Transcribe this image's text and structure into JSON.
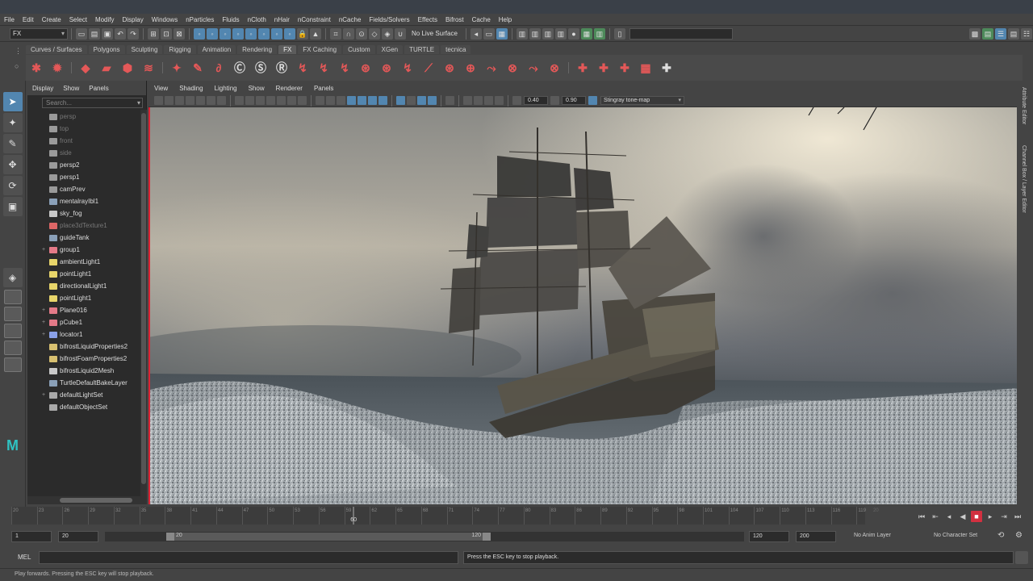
{
  "menubar": {
    "items": [
      "File",
      "Edit",
      "Create",
      "Select",
      "Modify",
      "Display",
      "Windows",
      "nParticles",
      "Fluids",
      "nCloth",
      "nHair",
      "nConstraint",
      "nCache",
      "Fields/Solvers",
      "Effects",
      "Bifrost",
      "Cache",
      "Help"
    ]
  },
  "statusline": {
    "menu_set": "FX",
    "live_surface": "No Live Surface"
  },
  "shelf": {
    "tabs": [
      "Curves / Surfaces",
      "Polygons",
      "Sculpting",
      "Rigging",
      "Animation",
      "Rendering",
      "FX",
      "FX Caching",
      "Custom",
      "XGen",
      "TURTLE",
      "tecnica"
    ],
    "active_tab": "FX"
  },
  "outliner": {
    "menu": [
      "Display",
      "Show",
      "Panels"
    ],
    "search_placeholder": "Search...",
    "items": [
      {
        "label": "persp",
        "icon": "camera",
        "dim": true,
        "expand": ""
      },
      {
        "label": "top",
        "icon": "camera",
        "dim": true,
        "expand": ""
      },
      {
        "label": "front",
        "icon": "camera",
        "dim": true,
        "expand": ""
      },
      {
        "label": "side",
        "icon": "camera",
        "dim": true,
        "expand": ""
      },
      {
        "label": "persp2",
        "icon": "camera",
        "dim": false,
        "expand": ""
      },
      {
        "label": "persp1",
        "icon": "camera",
        "dim": false,
        "expand": ""
      },
      {
        "label": "camPrev",
        "icon": "camera",
        "dim": false,
        "expand": ""
      },
      {
        "label": "mentalrayIbl1",
        "icon": "mesh",
        "dim": false,
        "expand": ""
      },
      {
        "label": "sky_fog",
        "icon": "fog",
        "dim": false,
        "expand": ""
      },
      {
        "label": "place3dTexture1",
        "icon": "texture",
        "dim": true,
        "expand": ""
      },
      {
        "label": "guideTank",
        "icon": "mesh",
        "dim": false,
        "expand": ""
      },
      {
        "label": "group1",
        "icon": "group",
        "dim": false,
        "expand": "+"
      },
      {
        "label": "ambientLight1",
        "icon": "light",
        "dim": false,
        "expand": ""
      },
      {
        "label": "pointLight1",
        "icon": "light",
        "dim": false,
        "expand": ""
      },
      {
        "label": "directionalLight1",
        "icon": "light",
        "dim": false,
        "expand": ""
      },
      {
        "label": "pointLight1",
        "icon": "light",
        "dim": false,
        "expand": ""
      },
      {
        "label": "Plane016",
        "icon": "group",
        "dim": false,
        "expand": "+"
      },
      {
        "label": "pCube1",
        "icon": "group",
        "dim": false,
        "expand": "+"
      },
      {
        "label": "locator1",
        "icon": "locator",
        "dim": false,
        "expand": "+"
      },
      {
        "label": "bifrostLiquidProperties2",
        "icon": "props",
        "dim": false,
        "expand": ""
      },
      {
        "label": "bifrostFoamProperties2",
        "icon": "props",
        "dim": false,
        "expand": ""
      },
      {
        "label": "bifrostLiquid2Mesh",
        "icon": "fog",
        "dim": false,
        "expand": ""
      },
      {
        "label": "TurtleDefaultBakeLayer",
        "icon": "mesh",
        "dim": false,
        "expand": ""
      },
      {
        "label": "defaultLightSet",
        "icon": "set",
        "dim": false,
        "expand": "+"
      },
      {
        "label": "defaultObjectSet",
        "icon": "set",
        "dim": false,
        "expand": ""
      }
    ]
  },
  "viewport": {
    "menu": [
      "View",
      "Shading",
      "Lighting",
      "Show",
      "Renderer",
      "Panels"
    ],
    "exposure": "0.40",
    "gamma": "0.90",
    "tone_map": "Stingray tone-map"
  },
  "right_dock": {
    "tabs": [
      "Attribute Editor",
      "Channel Box / Layer Editor"
    ]
  },
  "timeline": {
    "ticks": [
      "20",
      "23",
      "26",
      "29",
      "32",
      "35",
      "38",
      "41",
      "44",
      "47",
      "50",
      "53",
      "56",
      "59",
      "62",
      "65",
      "68",
      "71",
      "74",
      "77",
      "80",
      "83",
      "86",
      "89",
      "92",
      "95",
      "98",
      "101",
      "104",
      "107",
      "110",
      "113",
      "116",
      "119"
    ],
    "tick_start": 20,
    "tick_end": 120,
    "current_frame": "60",
    "current_frame_value": 60,
    "end_label": "20"
  },
  "range": {
    "start_time": "1",
    "playback_start": "20",
    "range_start_label": "20",
    "range_end_label": "120",
    "playback_end": "120",
    "end_time": "200",
    "anim_layer": "No Anim Layer",
    "character_set": "No Character Set"
  },
  "command_line": {
    "label": "MEL",
    "output": "Press the ESC key to stop playback."
  },
  "help_line": {
    "text": "Play forwards. Pressing the ESC key will stop playback."
  },
  "colors": {
    "accent": "#5286b0",
    "stop": "#d23040",
    "shelf_icon": "#e45858"
  }
}
